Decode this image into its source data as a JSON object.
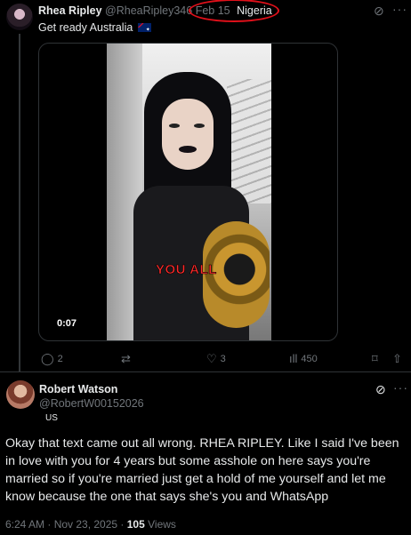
{
  "tweet": {
    "display_name": "Rhea Ripley",
    "handle": "@RheaRipley346",
    "date": "Feb 15",
    "location": "Nigeria",
    "text": "Get ready Australia",
    "video": {
      "caption": "YOU ALL",
      "duration": "0:07"
    },
    "actions": {
      "replies": "2",
      "reposts": "",
      "likes": "3",
      "views": "450"
    }
  },
  "reply": {
    "display_name": "Robert Watson",
    "handle": "@RobertW00152026",
    "flag_text": "US",
    "text": "Okay that text came out all wrong. RHEA RIPLEY. Like I said I've been in love with you for 4 years but some asshole on here says you're married so if you're married just get a hold of me yourself and let me know because the one that says she's you and WhatsApp",
    "timestamp": "6:24 AM · Nov 23, 2025 · ",
    "views_count": "105",
    "views_label": " Views"
  },
  "colors": {
    "background": "#000000",
    "text": "#e7e9ea",
    "muted": "#71767b",
    "annotation": "#e0101a"
  }
}
